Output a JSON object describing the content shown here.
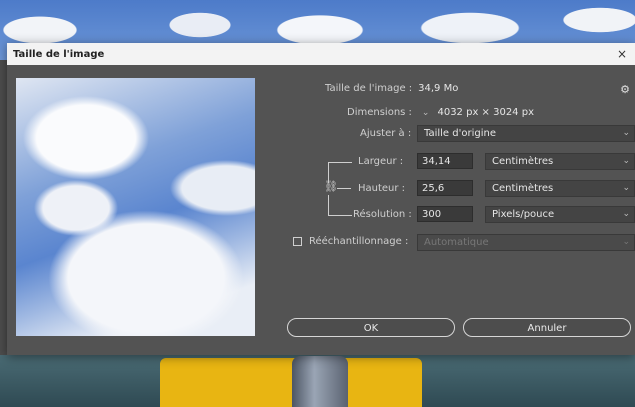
{
  "dialog": {
    "title": "Taille de l'image",
    "close_glyph": "×",
    "image_size_label": "Taille de l'image :",
    "image_size_value": "34,9 Mo",
    "dimensions_label": "Dimensions :",
    "dimensions_value": "4032 px  ×  3024 px",
    "fit_label": "Ajuster à :",
    "fit_value": "Taille d'origine",
    "width_label": "Largeur :",
    "width_value": "34,14",
    "width_unit": "Centimètres",
    "height_label": "Hauteur :",
    "height_value": "25,6",
    "height_unit": "Centimètres",
    "resolution_label": "Résolution :",
    "resolution_value": "300",
    "resolution_unit": "Pixels/pouce",
    "resample_label": "Rééchantillonnage :",
    "resample_value": "Automatique",
    "ok_label": "OK",
    "cancel_label": "Annuler"
  },
  "icons": {
    "gear": "gear-icon",
    "link": "link-icon",
    "chevron": "chevron-down-icon",
    "close": "close-icon"
  },
  "colors": {
    "dialog_bg": "#535353",
    "titlebar_bg": "#f3f3f3",
    "input_bg": "#3a3a3a",
    "boat_yellow": "#e8b512"
  }
}
